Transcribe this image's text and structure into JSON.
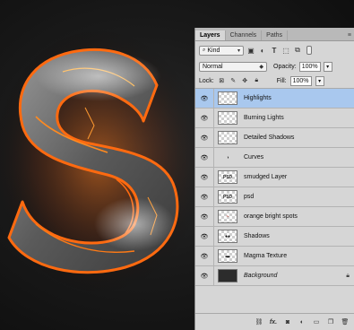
{
  "panel": {
    "tabs": [
      {
        "label": "Layers",
        "active": true
      },
      {
        "label": "Channels",
        "active": false
      },
      {
        "label": "Paths",
        "active": false
      }
    ],
    "menu_icon": "panel-menu-icon",
    "filter": {
      "kind_label": "Kind",
      "icons": [
        "image-filter-icon",
        "adjustment-filter-icon",
        "type-filter-icon",
        "shape-filter-icon",
        "smart-object-filter-icon"
      ]
    },
    "blend_mode": "Normal",
    "opacity_label": "Opacity:",
    "opacity_value": "100%",
    "lock_label": "Lock:",
    "fill_label": "Fill:",
    "fill_value": "100%",
    "layers": [
      {
        "name": "Highlights",
        "thumb": "checker",
        "selected": true
      },
      {
        "name": "Burning Lights",
        "thumb": "checker",
        "selected": false
      },
      {
        "name": "Detailed Shadows",
        "thumb": "checker",
        "selected": false
      },
      {
        "name": "Curves",
        "thumb": "adjustment",
        "selected": false
      },
      {
        "name": "smudged Layer",
        "thumb": "psd",
        "thumb_text": "PSD",
        "selected": false
      },
      {
        "name": "psd",
        "thumb": "psd",
        "thumb_text": "PSD",
        "selected": false
      },
      {
        "name": "orange bright spots",
        "thumb": "checker-red",
        "selected": false
      },
      {
        "name": "Shadows",
        "thumb": "checker-dark",
        "selected": false
      },
      {
        "name": "Magma Texture",
        "thumb": "checker-dark",
        "selected": false
      },
      {
        "name": "Background",
        "thumb": "dark",
        "selected": false,
        "locked": true
      }
    ],
    "footer_icons": [
      "link-layers-icon",
      "fx-icon",
      "add-mask-icon",
      "adjustment-layer-icon",
      "new-group-icon",
      "new-layer-icon",
      "delete-layer-icon"
    ],
    "footer_fx_label": "fx."
  },
  "colors": {
    "selected_row": "#a9c8ee",
    "panel_bg": "#d6d6d6",
    "lava": "#ff5a0a"
  }
}
